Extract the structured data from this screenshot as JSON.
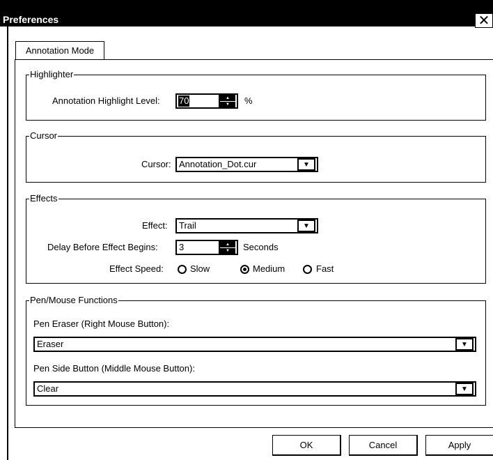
{
  "window": {
    "title": "Preferences",
    "close_glyph": "✕"
  },
  "tabs": [
    {
      "label": "Annotation Mode"
    }
  ],
  "highlighter": {
    "legend": "Highlighter",
    "level_label": "Annotation Highlight Level:",
    "level_value": "70",
    "unit": "%"
  },
  "cursor": {
    "legend": "Cursor",
    "label": "Cursor:",
    "value": "Annotation_Dot.cur"
  },
  "effects": {
    "legend": "Effects",
    "effect_label": "Effect:",
    "effect_value": "Trail",
    "delay_label": "Delay Before Effect Begins:",
    "delay_value": "3",
    "delay_unit": "Seconds",
    "speed_label": "Effect Speed:",
    "speed_options": [
      "Slow",
      "Medium",
      "Fast"
    ],
    "speed_selected": "Medium"
  },
  "pen": {
    "legend": "Pen/Mouse Functions",
    "eraser_label": "Pen Eraser (Right Mouse Button):",
    "eraser_value": "Eraser",
    "side_label": "Pen Side Button  (Middle Mouse Button):",
    "side_value": "Clear"
  },
  "buttons": {
    "ok": "OK",
    "cancel": "Cancel",
    "apply": "Apply"
  },
  "icons": {
    "spin": "spin-arrows-icon",
    "dropdown": "chevron-down-icon",
    "close": "close-icon"
  }
}
